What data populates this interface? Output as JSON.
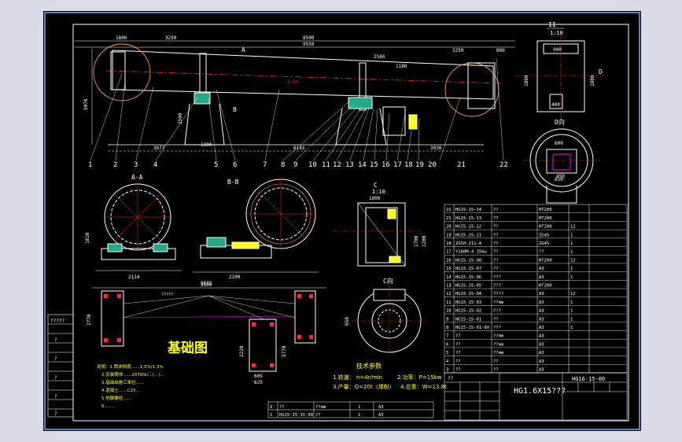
{
  "drawing": {
    "background": "#000000",
    "frame_color": "#ffffff",
    "line_color": "#ffffff",
    "accent_red": "#ff2a2a",
    "accent_yellow": "#ffff00",
    "accent_green": "#00ff66",
    "accent_magenta": "#ff00ff",
    "accent_cyan": "#55d6ff"
  },
  "elevation": {
    "dims_top": [
      "1800",
      "3250",
      "8500",
      "9550",
      "3250",
      "800"
    ],
    "dims_mid": [
      "2580",
      "1180"
    ],
    "dims_left": [
      "5070",
      "2500",
      "3677"
    ],
    "dims_bottom": [
      "6145",
      "3036",
      "1300"
    ],
    "slope": "1:2%",
    "section_mark_a": "A",
    "section_mark_b": "B",
    "section_mark_d": "D",
    "part_numbers": [
      "1",
      "2",
      "3",
      "4",
      "5",
      "6",
      "7",
      "8",
      "9",
      "10",
      "11",
      "12",
      "13",
      "14",
      "15",
      "16",
      "17",
      "18",
      "19",
      "20",
      "21",
      "22"
    ]
  },
  "right_view": {
    "title": "II",
    "scale": "1:10",
    "dims": [
      "900",
      "1800",
      "1800",
      "400"
    ]
  },
  "section_d": {
    "title": "D向",
    "dims": [
      "600",
      "450",
      "850"
    ]
  },
  "section_aa": {
    "title": "A-A",
    "dims": [
      "1810",
      "2114"
    ]
  },
  "section_bb": {
    "title": "B-B",
    "dims": [
      "2100",
      "3500"
    ]
  },
  "view_c": {
    "title": "C",
    "scale": "1:10",
    "dims": [
      "1800",
      "1700",
      "1200"
    ]
  },
  "view_c_dir": {
    "title": "C向",
    "dims": [
      "650"
    ]
  },
  "foundation": {
    "title": "基础图",
    "dims": [
      "8685",
      "2770",
      "2220",
      "605",
      "625",
      "5770"
    ],
    "label_lines": "?????"
  },
  "notes": {
    "lines": [
      "说明：1.筒体斜度……1:5%/1:3%",
      "2.安装筒体……2070%/…(…)…",
      "3.基础由施工单位……",
      "4.混凝土……C15…",
      "5.地脚螺栓……",
      "6.……"
    ]
  },
  "tech": {
    "title": "技术参数",
    "items": [
      "1.转速： n=4r/min",
      "2.功率：P=15kw",
      "3.产量：Q=20t（煤粉）",
      "4.总重：W=13.8t"
    ]
  },
  "title_block": {
    "drawing_name": "HG1.6X15???",
    "drawing_no": "HG16-15-00",
    "qmarks": "??"
  },
  "bom": {
    "rows": [
      [
        "22",
        "HG15-15-14",
        "??",
        "HT200",
        ""
      ],
      [
        "21",
        "HG15-15-13",
        "??",
        "HT200",
        ""
      ],
      [
        "20",
        "HG15-15-12",
        "??",
        "HT200",
        "12"
      ],
      [
        "19",
        "HG15-15-11",
        "??",
        "ZG45",
        "1"
      ],
      [
        "18",
        "ZG50-211-4",
        "??",
        "ZG45",
        "1"
      ],
      [
        "17",
        "Y160M-4 15kw",
        "??",
        "??",
        "1"
      ],
      [
        "16",
        "HG15-15-08",
        "??",
        "HT200",
        "12"
      ],
      [
        "15",
        "HG15-15-07",
        "??",
        "A3",
        "1"
      ],
      [
        "14",
        "HG15-15-06",
        "???",
        "A3",
        "1"
      ],
      [
        "13",
        "HG15-15-05",
        "???",
        "HT200",
        ""
      ],
      [
        "12",
        "HG15-15-04",
        "????",
        "A3",
        "12"
      ],
      [
        "11",
        "HG15-15-03",
        "??mm",
        "A3",
        "1"
      ],
      [
        "10",
        "HG15-15-02",
        "???",
        "A3",
        "1"
      ],
      [
        "9",
        "HG15-15-01",
        "??",
        "A3",
        "1"
      ],
      [
        "8",
        "HG15-15-01-00",
        "???",
        "A3",
        "1"
      ],
      [
        "7",
        "??",
        "??mm",
        "A3",
        ""
      ],
      [
        "6",
        "??",
        "??mm",
        "A3",
        ""
      ],
      [
        "5",
        "??",
        "??mm",
        "A3",
        ""
      ],
      [
        "4",
        "??",
        "??",
        "A3",
        ""
      ],
      [
        "3",
        "??",
        "??",
        "A3",
        ""
      ]
    ],
    "footer_rows": [
      [
        "2",
        "??",
        "??mm",
        "1",
        "A3"
      ],
      [
        "1",
        "HG15-15-15-00",
        "??",
        "1",
        "A3"
      ]
    ]
  },
  "left_legend": [
    "?????",
    "?",
    "?",
    "?",
    "?",
    "?",
    "?",
    "?",
    "?",
    "?",
    "?",
    "?"
  ]
}
